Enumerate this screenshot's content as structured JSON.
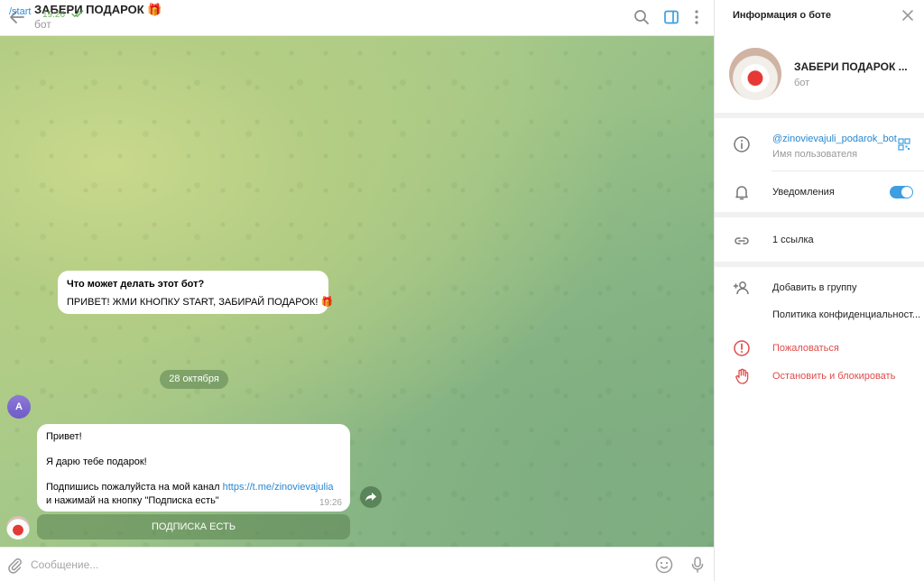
{
  "chat": {
    "title": "ЗАБЕРИ ПОДАРОК 🎁",
    "subtitle": "бот",
    "intro": {
      "title": "Что может делать этот бот?",
      "text": "ПРИВЕТ! ЖМИ КНОПКУ START, ЗАБИРАЙ ПОДАРОК! 🎁"
    },
    "date_badge": "28 октября",
    "user_avatar_letter": "A",
    "outgoing": {
      "text": "/start",
      "time": "19:26"
    },
    "incoming": {
      "line1": "Привет!",
      "line2": "Я дарю тебе подарок!",
      "line3_prefix": "Подпишись пожалуйста на мой канал ",
      "line3_link": "https://t.me/zinovievajulia",
      "line4": "и нажимай на кнопку \"Подписка есть\"",
      "time": "19:26"
    },
    "inline_button": "ПОДПИСКА ЕСТЬ",
    "composer_placeholder": "Сообщение..."
  },
  "info_panel": {
    "title": "Информация о боте",
    "bot_name": "ЗАБЕРИ ПОДАРОК ...",
    "bot_status": "бот",
    "username": "@zinovievajuli_podarok_bot",
    "username_caption": "Имя пользователя",
    "notifications_label": "Уведомления",
    "notifications_enabled": true,
    "links_label": "1 ссылка",
    "add_to_group": "Добавить в группу",
    "privacy_policy": "Политика конфиденциальност...",
    "report": "Пожаловаться",
    "block": "Остановить и блокировать"
  },
  "colors": {
    "accent": "#3d9fe0",
    "link": "#2a87d0",
    "danger": "#e14b4b",
    "outgoing_bubble": "#effdde"
  },
  "icons": [
    "back-arrow-icon",
    "search-icon",
    "sidebar-toggle-icon",
    "more-vert-icon",
    "close-icon",
    "info-icon",
    "qr-code-icon",
    "bell-icon",
    "link-icon",
    "add-user-icon",
    "report-icon",
    "stop-hand-icon",
    "attach-icon",
    "emoji-icon",
    "mic-icon",
    "share-icon",
    "double-check-icon"
  ]
}
